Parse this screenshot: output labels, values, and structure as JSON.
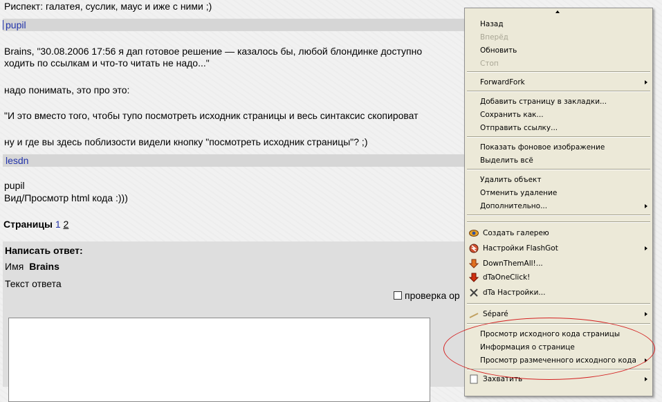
{
  "forum": {
    "line_top": "Риспект: галатея, суслик, маус и иже с ними ;)",
    "user1": "pupil",
    "post1_line1": "Brains, \"30.08.2006 17:56 я дап готовое решение — казалось бы, любой блондинке доступно",
    "post1_line2": "ходить по ссылкам и что-то читать не надо...\"",
    "post1_line3": "надо понимать, это про это:",
    "post1_line4": "\"И это вместо того, чтобы тупо посмотреть исходник страницы и весь синтаксис скопироват",
    "post1_line5": "ну и где вы здесь поблизости видели кнопку \"посмотреть исходник страницы\"? ;)",
    "user2": "lesdn",
    "post2_line1": "pupil",
    "post2_line2": "Вид/Просмотр html кода :)))",
    "pages_label": "Страницы",
    "page1": "1",
    "page2": "2"
  },
  "reply": {
    "header": "Написать ответ:",
    "name_label": "Имя",
    "name_value": "Brains",
    "text_label": "Текст ответа",
    "spellcheck_label": "проверка ор"
  },
  "context_menu": {
    "back": "Назад",
    "forward": "Вперёд",
    "reload": "Обновить",
    "stop": "Стоп",
    "forwardfork": "ForwardFork",
    "bookmark": "Добавить страницу в закладки...",
    "save_as": "Сохранить как...",
    "send_link": "Отправить ссылку...",
    "view_bg": "Показать фоновое изображение",
    "select_all": "Выделить всё",
    "delete_obj": "Удалить объект",
    "undo_delete": "Отменить удаление",
    "more": "Дополнительно...",
    "create_gallery": "Создать галерею",
    "flashgot_settings": "Настройки FlashGot",
    "downthemall": "DownThemAll!...",
    "dta_oneclick": "dTaOneClick!",
    "dta_settings": "dTa Настройки...",
    "separe": "Séparé",
    "view_source": "Просмотр исходного кода страницы",
    "page_info": "Информация о странице",
    "view_selection_source": "Просмотр размеченного исходного кода",
    "capture": "Захватить"
  },
  "colors": {
    "link": "#2233aa",
    "menu_bg": "#ece9d8",
    "annotation": "#d42020"
  }
}
